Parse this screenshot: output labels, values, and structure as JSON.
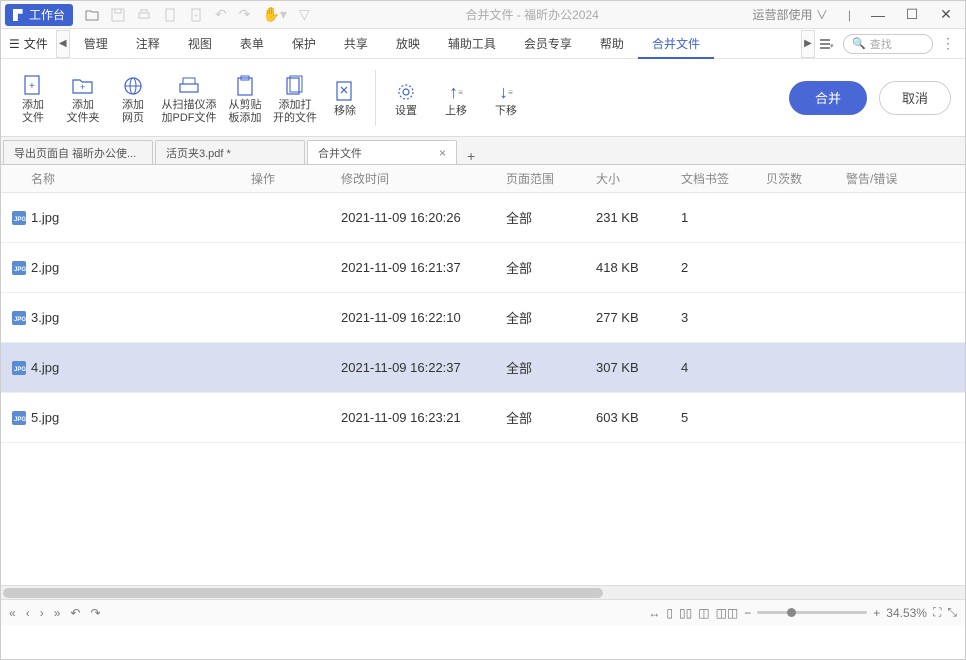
{
  "titlebar": {
    "workspace": "工作台",
    "title": "合并文件 - 福昕办公2024",
    "user": "运营部使用"
  },
  "menu": {
    "file": "文件",
    "items": [
      "管理",
      "注释",
      "视图",
      "表单",
      "保护",
      "共享",
      "放映",
      "辅助工具",
      "会员专享",
      "帮助",
      "合并文件"
    ],
    "activeIndex": 10,
    "search_placeholder": "查找"
  },
  "ribbon": {
    "add_file": "添加\n文件",
    "add_folder": "添加\n文件夹",
    "add_web": "添加\n网页",
    "from_scan": "从扫描仪添\n加PDF文件",
    "from_clip": "从剪贴\n板添加",
    "add_open": "添加打\n开的文件",
    "remove": "移除",
    "settings": "设置",
    "up": "上移",
    "down": "下移",
    "merge": "合并",
    "cancel": "取消"
  },
  "tabs": {
    "t0": "导出页面自 福昕办公使...",
    "t1": "活页夹3.pdf *",
    "t2": "合并文件"
  },
  "columns": {
    "name": "名称",
    "op": "操作",
    "date": "修改时间",
    "range": "页面范围",
    "size": "大小",
    "bookmark": "文档书签",
    "bates": "贝茨数",
    "warn": "警告/错误"
  },
  "rows": [
    {
      "name": "1.jpg",
      "date": "2021-11-09 16:20:26",
      "range": "全部",
      "size": "231 KB",
      "bm": "1"
    },
    {
      "name": "2.jpg",
      "date": "2021-11-09 16:21:37",
      "range": "全部",
      "size": "418 KB",
      "bm": "2"
    },
    {
      "name": "3.jpg",
      "date": "2021-11-09 16:22:10",
      "range": "全部",
      "size": "277 KB",
      "bm": "3"
    },
    {
      "name": "4.jpg",
      "date": "2021-11-09 16:22:37",
      "range": "全部",
      "size": "307 KB",
      "bm": "4"
    },
    {
      "name": "5.jpg",
      "date": "2021-11-09 16:23:21",
      "range": "全部",
      "size": "603 KB",
      "bm": "5"
    }
  ],
  "selectedRow": 3,
  "status": {
    "zoom": "34.53%"
  }
}
